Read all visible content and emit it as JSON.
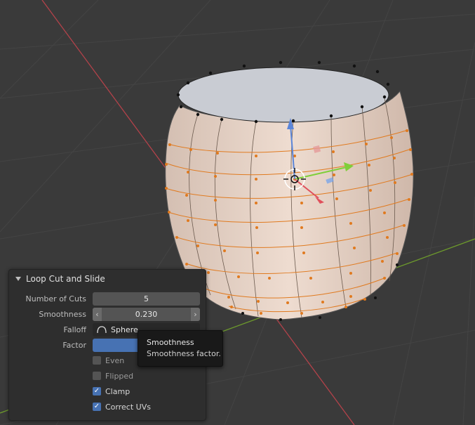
{
  "panel": {
    "title": "Loop Cut and Slide",
    "number_of_cuts": {
      "label": "Number of Cuts",
      "value": "5"
    },
    "smoothness": {
      "label": "Smoothness",
      "value": "0.230"
    },
    "falloff": {
      "label": "Falloff",
      "value": "Sphere",
      "icon": "sphere-falloff-icon"
    },
    "factor": {
      "label": "Factor",
      "value": "0"
    },
    "checkboxes": [
      {
        "label": "Even",
        "checked": false
      },
      {
        "label": "Flipped",
        "checked": false
      },
      {
        "label": "Clamp",
        "checked": true
      },
      {
        "label": "Correct UVs",
        "checked": true
      }
    ]
  },
  "tooltip": {
    "title": "Smoothness",
    "description": "Smoothness factor."
  },
  "colors": {
    "viewport_bg": "#3a3a3a",
    "x_axis": "#b3424a",
    "y_axis": "#6d9a2c",
    "selected_edge": "#e07a1f",
    "field_blue": "#4772b3"
  }
}
